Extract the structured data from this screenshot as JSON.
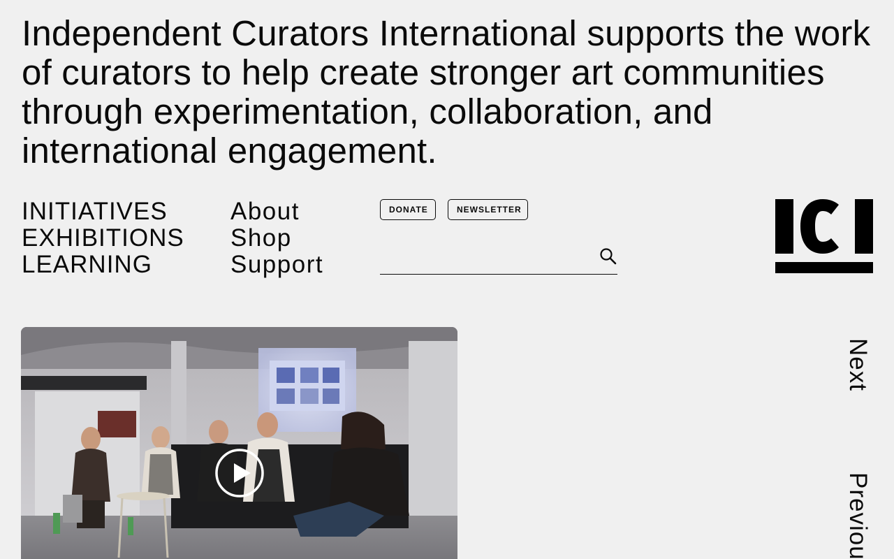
{
  "intro": {
    "text": "Independent Curators International supports the work of curators to help create stronger art communities through experimentation, collaboration, and international engagement."
  },
  "nav": {
    "primary": [
      "INITIATIVES",
      "EXHIBITIONS",
      "LEARNING"
    ],
    "secondary": [
      "About",
      "Shop",
      "Support"
    ]
  },
  "buttons": {
    "donate": "DONATE",
    "newsletter": "NEWSLETTER"
  },
  "search": {
    "value": "",
    "icon": "search-icon"
  },
  "logo": {
    "text": "ICI"
  },
  "media": {
    "play_icon": "play-icon",
    "projected_caption": ""
  },
  "carousel": {
    "next": "Next",
    "previous": "Previous"
  },
  "colors": {
    "background": "#f0f0f0",
    "text": "#0a0a0a",
    "accent": "#000000"
  }
}
